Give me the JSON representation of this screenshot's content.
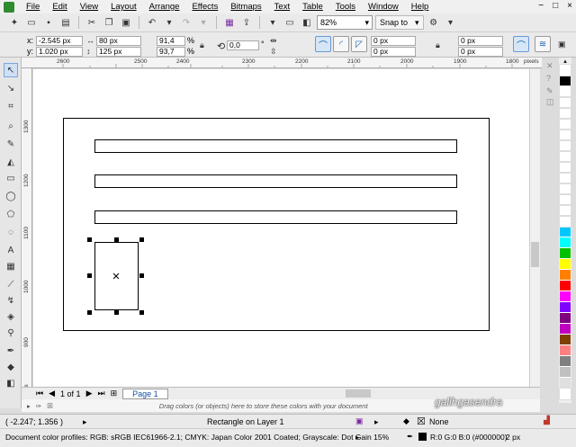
{
  "menu": [
    "File",
    "Edit",
    "View",
    "Layout",
    "Arrange",
    "Effects",
    "Bitmaps",
    "Text",
    "Table",
    "Tools",
    "Window",
    "Help"
  ],
  "window_controls": [
    "−",
    "□",
    "×"
  ],
  "toolbar": {
    "zoom_value": "82%",
    "snap_label": "Snap to"
  },
  "property_bar": {
    "x_label": "x:",
    "x_value": "-2.545 px",
    "y_label": "y:",
    "y_value": "1.020 px",
    "width_value": "80 px",
    "height_value": "125 px",
    "scale_x": "91,4",
    "scale_y": "93,7",
    "percent": "%",
    "angle_value": "0,0",
    "degree": "°",
    "corner_tl": "0 px",
    "corner_bl": "0 px",
    "corner_tr": "0 px",
    "corner_br": "0 px"
  },
  "ruler": {
    "unit": "pixels",
    "h_ticks": [
      "2600",
      "2500",
      "2400",
      "2300",
      "2200",
      "2100",
      "2000",
      "1900",
      "1800"
    ],
    "v_ticks": [
      "1300",
      "1200",
      "1100",
      "1000",
      "900"
    ],
    "v_unit": "pixels"
  },
  "palette": [
    "#ffffff",
    "#000000",
    "#ffffff",
    "#ffffff",
    "#ffffff",
    "#ffffff",
    "#ffffff",
    "#ffffff",
    "#ffffff",
    "#ffffff",
    "#ffffff",
    "#ffffff",
    "#ffffff",
    "#ffffff",
    "#ffffff",
    "#00c8ff",
    "#00ffff",
    "#00c000",
    "#ffff00",
    "#ff8000",
    "#ff0000",
    "#ff00ff",
    "#8000ff",
    "#800080",
    "#c000c0",
    "#804000",
    "#ff8080",
    "#808080",
    "#c0c0c0",
    "#e0e0e0",
    "#ffffff"
  ],
  "page_nav": {
    "counter": "1 of 1",
    "page_tab": "Page 1"
  },
  "color_tray": "Drag colors (or objects) here to store these colors with your document",
  "watermark": "gallhgasendra",
  "status": {
    "cursor_pos": "( -2.247; 1.356 )",
    "selection": "Rectangle on Layer 1",
    "fill_label": "None",
    "color_profiles": "Document color profiles: RGB: sRGB IEC61966-2.1; CMYK: Japan Color 2001 Coated; Grayscale: Dot Gain 15%",
    "outline_color": "R:0 G:0 B:0 (#000000)",
    "outline_width": "2 px"
  }
}
